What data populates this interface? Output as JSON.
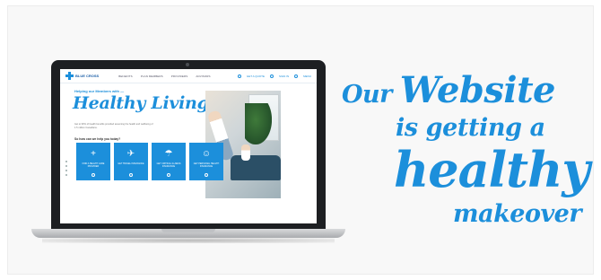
{
  "site": {
    "logo_text": "BLUE CROSS",
    "nav": [
      "BENEFITS",
      "PLAN MEMBERS",
      "PROVIDERS",
      "ADVISORS"
    ],
    "header_right": [
      "GET A QUOTE",
      "SIGN IN",
      "MENU"
    ],
    "hero_small": "Helping our Members with —",
    "hero_big": "Healthy Living",
    "hero_desc": "Get to 90% of health benefits provided assuming the health and wellbeing of 1.5 million Canadians.",
    "hero_question": "So how can we help you today?",
    "tiles": [
      {
        "icon": "plus-icon",
        "glyph": "+",
        "label": "Find a Health Care Provider"
      },
      {
        "icon": "plane-icon",
        "glyph": "✈",
        "label": "Get Travel Insurance"
      },
      {
        "icon": "umbrella-icon",
        "glyph": "☂",
        "label": "Get Critical Illness Insurance"
      },
      {
        "icon": "person-icon",
        "glyph": "☺",
        "label": "Get Personal Health Insurance"
      }
    ]
  },
  "headline": {
    "line1_a": "Our ",
    "line1_b": "Website",
    "line2": "is getting a",
    "line3": "healthy",
    "line4": "makeover"
  },
  "colors": {
    "brand_blue": "#1c8fdb"
  }
}
